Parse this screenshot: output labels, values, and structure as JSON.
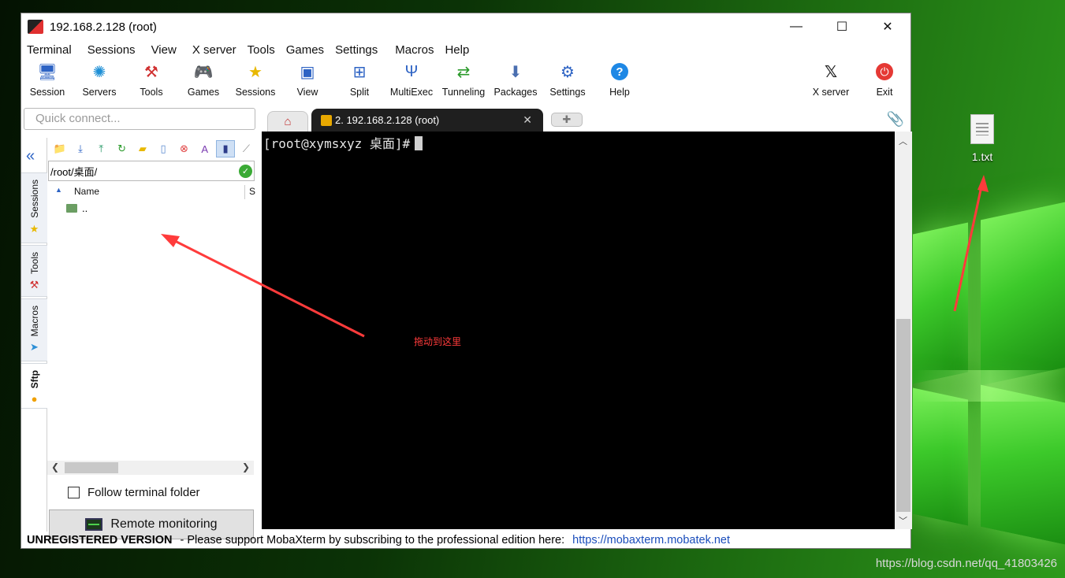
{
  "window": {
    "title": "192.168.2.128 (root)"
  },
  "menu": [
    "Terminal",
    "Sessions",
    "View",
    "X server",
    "Tools",
    "Games",
    "Settings",
    "Macros",
    "Help"
  ],
  "toolbar": {
    "left": [
      {
        "label": "Session",
        "icon": "monitor-icon"
      },
      {
        "label": "Servers",
        "icon": "servers-icon"
      },
      {
        "label": "Tools",
        "icon": "tools-icon"
      },
      {
        "label": "Games",
        "icon": "gamepad-icon"
      },
      {
        "label": "Sessions",
        "icon": "star-icon"
      },
      {
        "label": "View",
        "icon": "view-icon"
      },
      {
        "label": "Split",
        "icon": "split-icon"
      },
      {
        "label": "MultiExec",
        "icon": "fork-icon"
      },
      {
        "label": "Tunneling",
        "icon": "tunnel-icon"
      },
      {
        "label": "Packages",
        "icon": "packages-icon"
      },
      {
        "label": "Settings",
        "icon": "gears-icon"
      },
      {
        "label": "Help",
        "icon": "help-icon"
      }
    ],
    "right": [
      {
        "label": "X server",
        "icon": "xserver-icon"
      },
      {
        "label": "Exit",
        "icon": "power-icon"
      }
    ]
  },
  "quick_connect": {
    "placeholder": "Quick connect..."
  },
  "tabs": {
    "active_label": "2.  192.168.2.128 (root)"
  },
  "sidebar": {
    "tabs": [
      {
        "label": "Sessions",
        "icon": "star-icon"
      },
      {
        "label": "Tools",
        "icon": "tools-icon"
      },
      {
        "label": "Macros",
        "icon": "send-icon"
      },
      {
        "label": "Sftp",
        "icon": "sftp-icon"
      }
    ]
  },
  "sftp": {
    "path": "/root/桌面/",
    "columns": {
      "name": "Name",
      "size": "S"
    },
    "rows": [
      ".."
    ],
    "follow_label": "Follow terminal folder",
    "follow_checked": false,
    "remote_label": "Remote monitoring"
  },
  "terminal": {
    "prompt": "[root@xymsxyz 桌面]#"
  },
  "status": {
    "unregistered": "UNREGISTERED VERSION",
    "message": "-  Please support MobaXterm by subscribing to the professional edition here:",
    "link": "https://mobaxterm.mobatek.net"
  },
  "desktop": {
    "file_label": "1.txt",
    "watermark": "https://blog.csdn.net/qq_41803426"
  },
  "annotation": {
    "text": "拖动到这里",
    "color": "#ff3b3b"
  }
}
